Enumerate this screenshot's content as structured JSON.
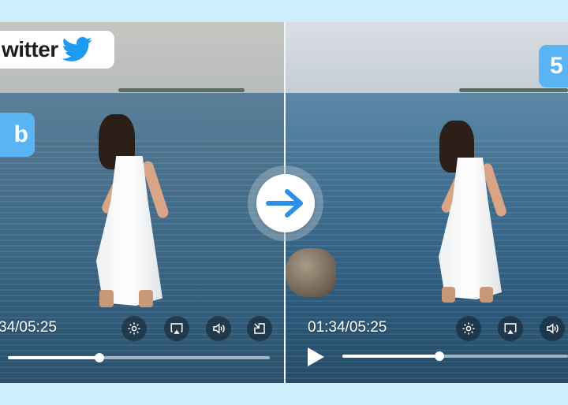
{
  "logo": {
    "text": "witter",
    "icon": "twitter-bird-icon"
  },
  "badges": {
    "left": "b",
    "right": "5"
  },
  "left_player": {
    "time": "34/05:25",
    "progress": 0.35
  },
  "right_player": {
    "time": "01:34/05:25",
    "progress": 0.43
  },
  "controls": [
    "gear-icon",
    "airplay-icon",
    "volume-icon",
    "pip-icon"
  ],
  "arrow": {
    "icon": "arrow-right-icon"
  },
  "colors": {
    "accent": "#5ab4f2",
    "arrow": "#2a8fe6",
    "background": "#cdeefb"
  }
}
